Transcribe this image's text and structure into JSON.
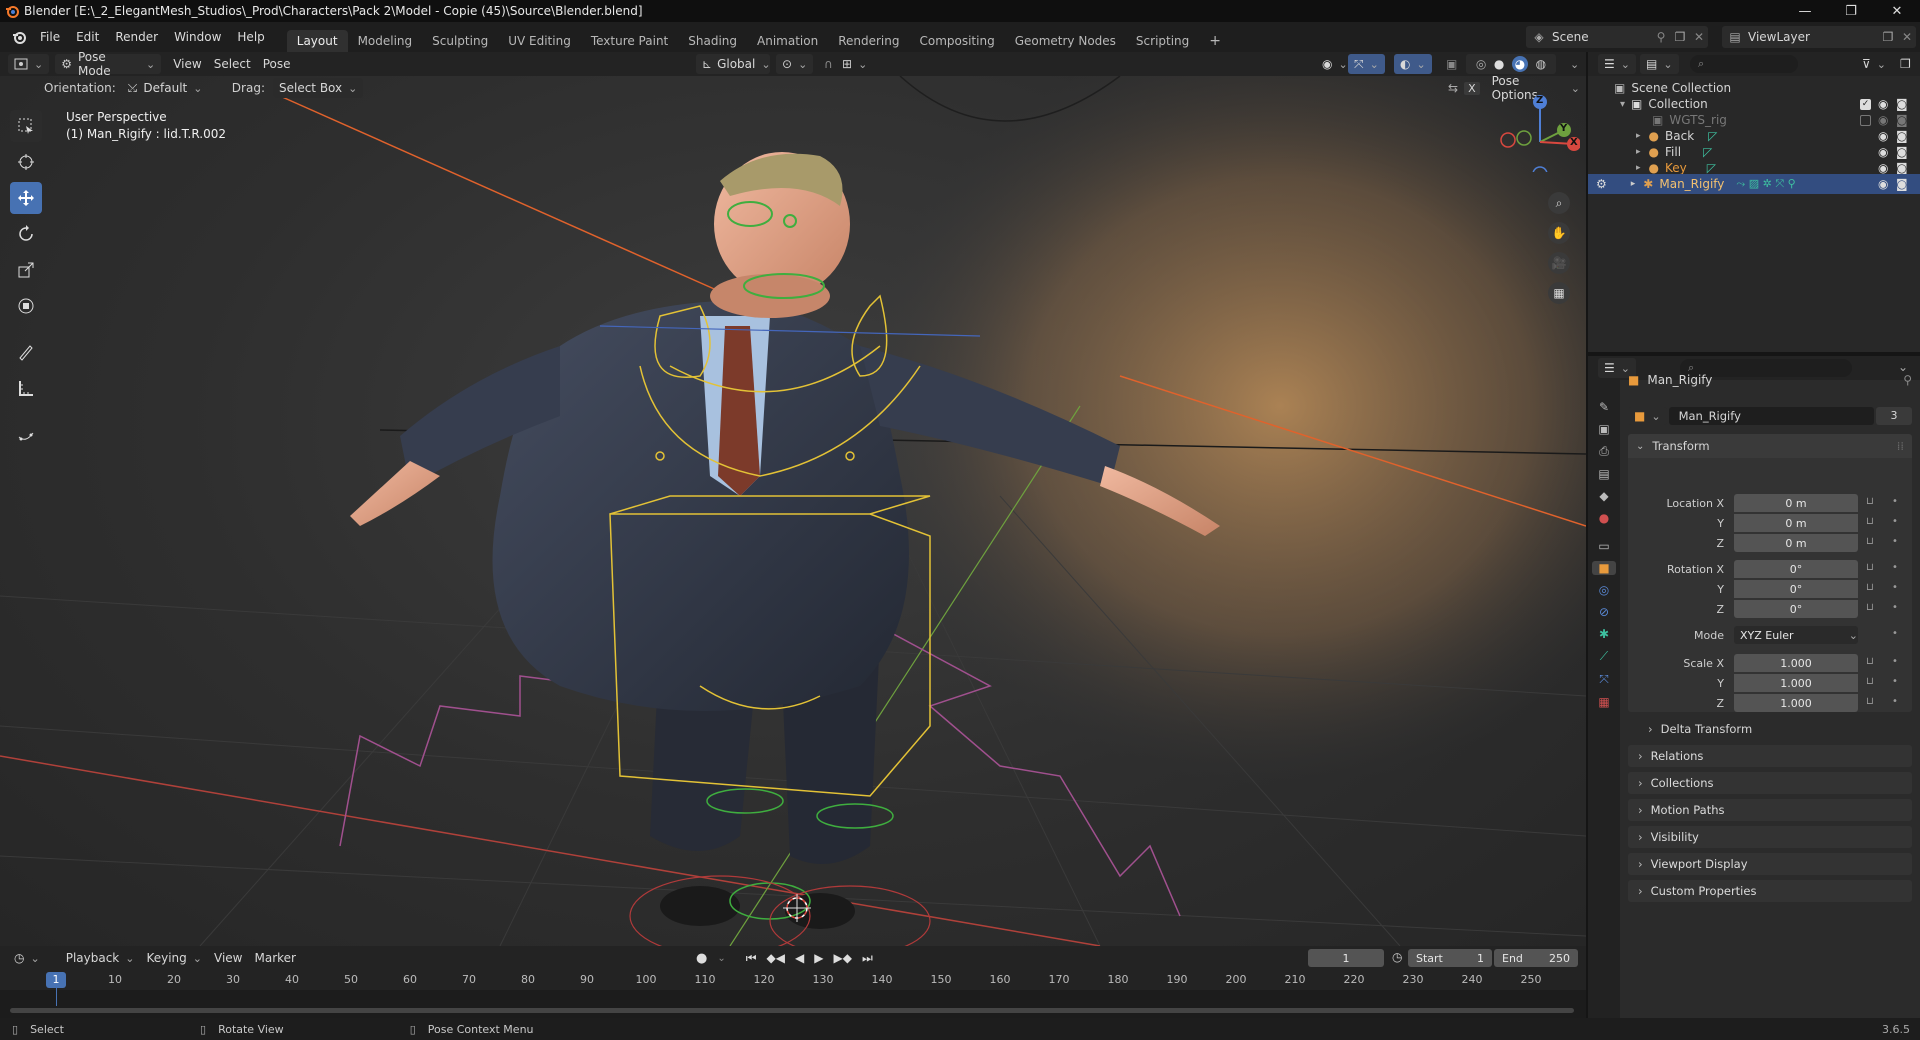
{
  "window": {
    "title": "Blender [E:\\_2_ElegantMesh_Studios\\_Prod\\Characters\\Pack 2\\Model - Copie (45)\\Source\\Blender.blend]"
  },
  "menu": {
    "items": [
      "File",
      "Edit",
      "Render",
      "Window",
      "Help"
    ],
    "workspaces": [
      "Layout",
      "Modeling",
      "Sculpting",
      "UV Editing",
      "Texture Paint",
      "Shading",
      "Animation",
      "Rendering",
      "Compositing",
      "Geometry Nodes",
      "Scripting"
    ],
    "active_workspace": "Layout",
    "scene": "Scene",
    "view_layer": "ViewLayer"
  },
  "viewport_header": {
    "mode": "Pose Mode",
    "menus": [
      "View",
      "Select",
      "Pose"
    ],
    "transform_orientation": "Global",
    "orientation_label": "Orientation:",
    "orientation_value": "Default",
    "drag_label": "Drag:",
    "drag_value": "Select Box",
    "pose_options": "Pose Options"
  },
  "viewport": {
    "perspective": "User Perspective",
    "active_info": "(1) Man_Rigify : lid.T.R.002",
    "gizmo_axes": [
      "Z",
      "Y",
      "X"
    ]
  },
  "outliner": {
    "scene_collection": "Scene Collection",
    "rows": [
      {
        "name": "Collection",
        "level": 1
      },
      {
        "name": "WGTS_rig",
        "level": 2,
        "dimmed": true
      },
      {
        "name": "Back",
        "level": 2
      },
      {
        "name": "Fill",
        "level": 2
      },
      {
        "name": "Key",
        "level": 2,
        "highlight": "orange"
      },
      {
        "name": "Man_Rigify",
        "level": 2,
        "selected": true
      }
    ]
  },
  "properties": {
    "object_name": "Man_Rigify",
    "data_name": "Man_Rigify",
    "data_users": "3",
    "transform_label": "Transform",
    "location_label": "Location X",
    "location": [
      "0 m",
      "0 m",
      "0 m"
    ],
    "rotation_label": "Rotation X",
    "rotation": [
      "0°",
      "0°",
      "0°"
    ],
    "mode_label": "Mode",
    "rotation_mode": "XYZ Euler",
    "scale_label": "Scale X",
    "scale": [
      "1.000",
      "1.000",
      "1.000"
    ],
    "axis_y": "Y",
    "axis_z": "Z",
    "delta_transform": "Delta Transform",
    "panels": [
      "Relations",
      "Collections",
      "Motion Paths",
      "Visibility",
      "Viewport Display",
      "Custom Properties"
    ]
  },
  "timeline": {
    "menus": [
      "Playback",
      "Keying",
      "View",
      "Marker"
    ],
    "current_frame": "1",
    "start_label": "Start",
    "start": "1",
    "end_label": "End",
    "end": "250",
    "ruler": [
      "1",
      "10",
      "20",
      "30",
      "40",
      "50",
      "60",
      "70",
      "80",
      "90",
      "100",
      "110",
      "120",
      "130",
      "140",
      "150",
      "160",
      "170",
      "180",
      "190",
      "200",
      "210",
      "220",
      "230",
      "240",
      "250"
    ]
  },
  "statusbar": {
    "select": "Select",
    "rotate": "Rotate View",
    "context": "Pose Context Menu",
    "version": "3.6.5"
  },
  "colors": {
    "accent": "#4772b3",
    "selected_row": "#334d80",
    "bone_yellow": "#e3c236",
    "bone_green": "#3fae3f",
    "axis_red": "#d8483f"
  }
}
